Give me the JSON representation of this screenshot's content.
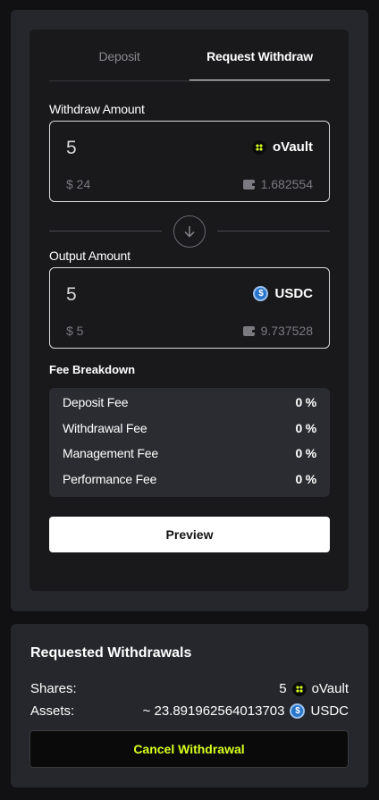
{
  "tabs": {
    "deposit": "Deposit",
    "request_withdraw": "Request Withdraw"
  },
  "withdraw": {
    "label": "Withdraw Amount",
    "amount": "5",
    "token": "oVault",
    "usd_value": "$ 24",
    "balance": "1.682554"
  },
  "output": {
    "label": "Output Amount",
    "amount": "5",
    "token": "USDC",
    "usd_value": "$ 5",
    "balance": "9.737528"
  },
  "fees": {
    "title": "Fee Breakdown",
    "rows": [
      {
        "name": "Deposit Fee",
        "value": "0 %"
      },
      {
        "name": "Withdrawal Fee",
        "value": "0 %"
      },
      {
        "name": "Management Fee",
        "value": "0 %"
      },
      {
        "name": "Performance Fee",
        "value": "0 %"
      }
    ]
  },
  "preview_label": "Preview",
  "requested": {
    "title": "Requested Withdrawals",
    "shares_label": "Shares:",
    "shares_value": "5",
    "shares_token": "oVault",
    "assets_label": "Assets:",
    "assets_value": "~ 23.891962564013703",
    "assets_token": "USDC",
    "cancel_label": "Cancel Withdrawal"
  },
  "colors": {
    "accent": "#d7ff1e",
    "usdc": "#2775ca",
    "panel": "#26272d",
    "card": "#19191b"
  },
  "icons": {
    "ovault": "ovault-token-icon",
    "usdc": "usdc-token-icon",
    "wallet": "wallet-icon",
    "arrow": "arrow-down-icon"
  }
}
